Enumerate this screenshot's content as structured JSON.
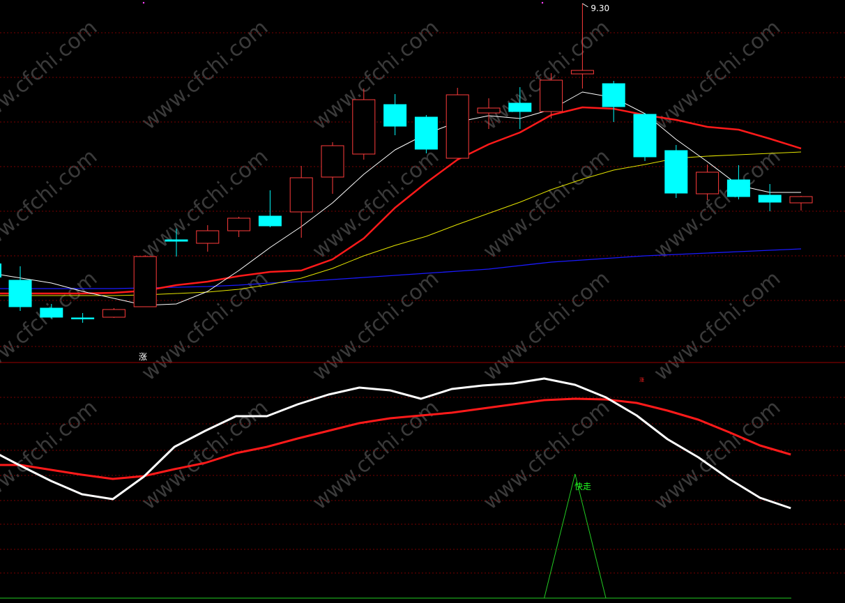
{
  "colors": {
    "background": "#000000",
    "up": "#ff3b3b",
    "down": "#00ffff",
    "ma_fast": "#ffffff",
    "ma_mid": "#ff1a1a",
    "ma_slow": "#e6e600",
    "ma_long": "#1a1aff",
    "grid": "#7a0000",
    "signal": "#22cc22"
  },
  "main_chart": {
    "high_label": "9.30",
    "zhang_label": "涨",
    "watermark": "www.cfchi.com"
  },
  "indicator": {
    "top_mark": "涨",
    "signal_label": "快走"
  },
  "chart_data": {
    "type": "candlestick",
    "candles": [
      {
        "o": [
          402
        ],
        "c": [
          440
        ],
        "h": [
          382
        ],
        "l": [
          446
        ],
        "up": false
      },
      {
        "o": [
          442
        ],
        "c": [
          455
        ],
        "h": [
          436
        ],
        "l": [
          457
        ],
        "up": false
      },
      {
        "o": [
          456
        ],
        "c": [
          457
        ],
        "h": [
          449
        ],
        "l": [
          463
        ],
        "up": false
      },
      {
        "o": [
          455
        ],
        "c": [
          444
        ],
        "h": [
          442
        ],
        "l": [
          456
        ],
        "up": true
      },
      {
        "o": [
          440
        ],
        "c": [
          368
        ],
        "h": [
          366
        ],
        "l": [
          440
        ],
        "up": true
      },
      {
        "o": [
          344
        ],
        "c": [
          346
        ],
        "h": [
          328
        ],
        "l": [
          368
        ],
        "up": false
      },
      {
        "o": [
          349
        ],
        "c": [
          331
        ],
        "h": [
          323
        ],
        "l": [
          361
        ],
        "up": true
      },
      {
        "o": [
          331
        ],
        "c": [
          313
        ],
        "h": [
          311
        ],
        "l": [
          340
        ],
        "up": true
      },
      {
        "o": [
          310
        ],
        "c": [
          324
        ],
        "h": [
          273
        ],
        "l": [
          326
        ],
        "up": false
      },
      {
        "o": [
          304
        ],
        "c": [
          255
        ],
        "h": [
          238
        ],
        "l": [
          341
        ],
        "up": true
      },
      {
        "o": [
          254
        ],
        "c": [
          209
        ],
        "h": [
          204
        ],
        "l": [
          278
        ],
        "up": true
      },
      {
        "o": [
          221
        ],
        "c": [
          143
        ],
        "h": [
          127
        ],
        "l": [
          229
        ],
        "up": true
      },
      {
        "o": [
          150
        ],
        "c": [
          181
        ],
        "h": [
          135
        ],
        "l": [
          194
        ],
        "up": false
      },
      {
        "o": [
          168
        ],
        "c": [
          214
        ],
        "h": [
          165
        ],
        "l": [
          220
        ],
        "up": false
      },
      {
        "o": [
          227
        ],
        "c": [
          136
        ],
        "h": [
          126
        ],
        "l": [
          227
        ],
        "up": true
      },
      {
        "o": [
          162
        ],
        "c": [
          155
        ],
        "h": [
          141
        ],
        "l": [
          185
        ],
        "up": true
      },
      {
        "o": [
          148
        ],
        "c": [
          160
        ],
        "h": [
          125
        ],
        "l": [
          185
        ],
        "up": false
      },
      {
        "o": [
          160
        ],
        "c": [
          115
        ],
        "h": [
          105
        ],
        "l": [
          170
        ],
        "up": true
      },
      {
        "o": [
          106
        ],
        "c": [
          101
        ],
        "h": [
          5
        ],
        "l": [
          127
        ],
        "up": true
      },
      {
        "o": [
          120
        ],
        "c": [
          153
        ],
        "h": [
          116
        ],
        "l": [
          175
        ],
        "up": false
      },
      {
        "o": [
          164
        ],
        "c": [
          225
        ],
        "h": [
          162
        ],
        "l": [
          231
        ],
        "up": false
      },
      {
        "o": [
          216
        ],
        "c": [
          277
        ],
        "h": [
          208
        ],
        "l": [
          284
        ],
        "up": false
      },
      {
        "o": [
          278
        ],
        "c": [
          247
        ],
        "h": [
          236
        ],
        "l": [
          287
        ],
        "up": true
      },
      {
        "o": [
          258
        ],
        "c": [
          282
        ],
        "h": [
          237
        ],
        "l": [
          286
        ],
        "up": false
      },
      {
        "o": [
          280
        ],
        "c": [
          290
        ],
        "h": [
          264
        ],
        "l": [
          303
        ],
        "up": false
      },
      {
        "o": [
          291
        ],
        "c": [
          282
        ],
        "h": [
          281
        ],
        "l": [
          302
        ],
        "up": true
      }
    ],
    "ma_fast": [
      394,
      406,
      418,
      428,
      438,
      436,
      418,
      388,
      355,
      325,
      291,
      250,
      215,
      192,
      175,
      166,
      170,
      157,
      132,
      140,
      163,
      200,
      232,
      266,
      276,
      276
    ],
    "ma_mid": [
      421,
      421,
      421,
      420,
      417,
      409,
      404,
      396,
      390,
      388,
      372,
      342,
      298,
      262,
      229,
      207,
      190,
      165,
      154,
      156,
      165,
      172,
      182,
      186,
      199,
      213
    ],
    "ma_slow": [
      424,
      424,
      424,
      424,
      423,
      421,
      419,
      415,
      408,
      399,
      385,
      367,
      352,
      339,
      322,
      306,
      290,
      272,
      257,
      244,
      236,
      227,
      224,
      222,
      220,
      218
    ],
    "ma_long": [
      414,
      414,
      414,
      414,
      413,
      412,
      411,
      409,
      406,
      404,
      401,
      398,
      395,
      392,
      389,
      386,
      381,
      376,
      373,
      370,
      367,
      365,
      363,
      361,
      359,
      357
    ],
    "ind_white": [
      645,
      668,
      690,
      709,
      716,
      684,
      641,
      618,
      597,
      597,
      580,
      566,
      556,
      560,
      572,
      558,
      553,
      550,
      543,
      552,
      570,
      596,
      630,
      656,
      687,
      714,
      729
    ],
    "ind_red": [
      667,
      667,
      674,
      681,
      687,
      683,
      673,
      664,
      650,
      641,
      629,
      618,
      607,
      600,
      596,
      592,
      586,
      580,
      574,
      572,
      573,
      578,
      589,
      602,
      620,
      639,
      652
    ],
    "signal": [
      858,
      858,
      858,
      858,
      858,
      858,
      858,
      858,
      858,
      858,
      858,
      858,
      858,
      858,
      858,
      858,
      858,
      858,
      858,
      680,
      858,
      858,
      858,
      858,
      858,
      858,
      858
    ]
  }
}
